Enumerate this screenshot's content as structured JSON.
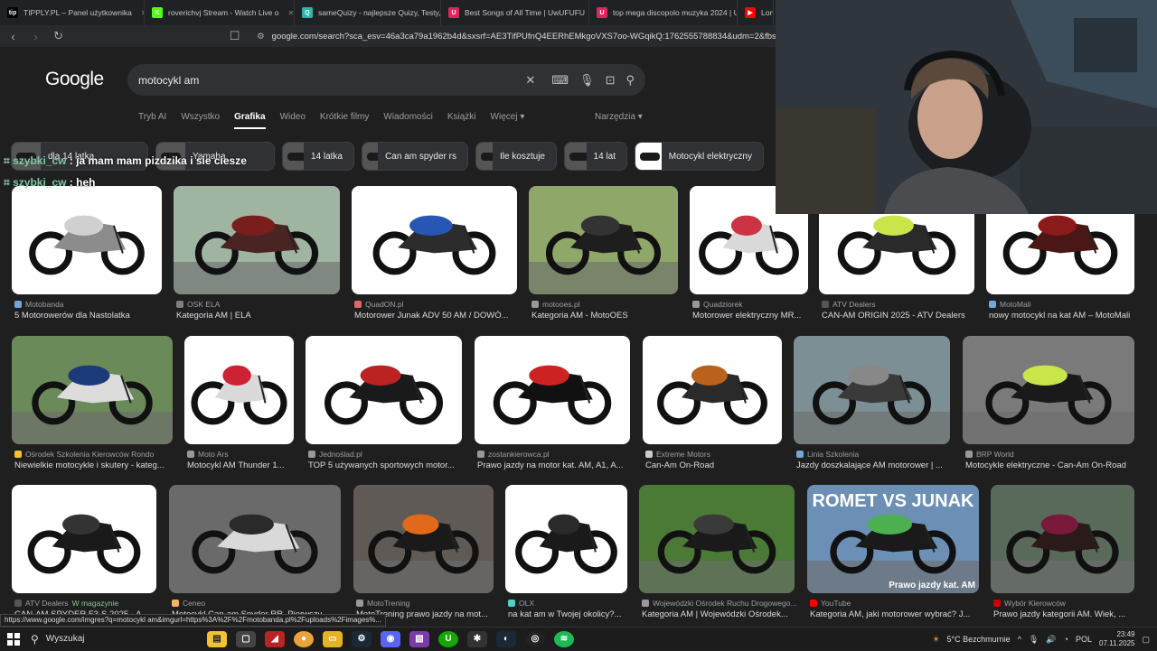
{
  "browser": {
    "tabs": [
      {
        "label": "TIPPLY.PL – Panel użytkownika",
        "fav": "tip",
        "color": "#000000"
      },
      {
        "label": "roverichvj Stream - Watch Live o",
        "fav": "K",
        "color": "#53fc18"
      },
      {
        "label": "sameQuizy - najlepsze Quizy, Testy, C",
        "fav": "Q",
        "color": "#2ab7a9"
      },
      {
        "label": "Best Songs of All Time | UwUFUFU",
        "fav": "U",
        "color": "#e0245e"
      },
      {
        "label": "top mega discopolo muzyka 2024 | U",
        "fav": "U",
        "color": "#e0245e"
      },
      {
        "label": "Long",
        "fav": "▶",
        "color": "#ff0000"
      }
    ],
    "url": "google.com/search?sca_esv=46a3ca79a1962b4d&sxsrf=AE3TifPUfnQ4EERhEMkgoVXS7oo-WGqikQ:1762555788834&udm=2&fbs=AIljpHwV"
  },
  "google": {
    "logo": "Google",
    "query": "motocykl am",
    "tabs": [
      "Tryb AI",
      "Wszystko",
      "Grafika",
      "Wideo",
      "Krótkie filmy",
      "Wiadomości",
      "Książki",
      "Więcej ▾"
    ],
    "active_tab": "Grafika",
    "tools": "Narzędzia ▾",
    "chips": [
      "dla 14 latka",
      "Yamaha",
      "14 latka",
      "Can am spyder rs",
      "Ile kosztuje",
      "14 lat",
      "Motocykl elektryczny"
    ]
  },
  "chat": [
    {
      "user": "szybki_cw",
      "message": "ja mam mam pizdzika i sie ciesze"
    },
    {
      "user": "szybki_cw",
      "message": "heh"
    }
  ],
  "results_rows": [
    [
      {
        "source": "Motobanda",
        "title": "5 Motorowerów dla Nastolatka",
        "icon": "#6fa8dc",
        "bg": "#ffffff",
        "bike": "#8c8c8c",
        "tank": "#d0d0d0"
      },
      {
        "source": "OSK ELA",
        "title": "Kategoria AM | ELA",
        "icon": "#7f7f7f",
        "bg": "#9fb5a1",
        "bike": "#4a2323",
        "tank": "#7a1d1d"
      },
      {
        "source": "QuadON.pl",
        "title": "Motorower Junak ADV 50 AM / DOWÓ...",
        "icon": "#e06666",
        "bg": "#ffffff",
        "bike": "#2c2c2c",
        "tank": "#2856b5"
      },
      {
        "source": "motooes.pl",
        "title": "Kategoria AM - MotoOES",
        "icon": "#999999",
        "bg": "#8fa86a",
        "bike": "#1e1e1e",
        "tank": "#333333"
      },
      {
        "source": "Quadziorek",
        "title": "Motorower elektryczny MR...",
        "icon": "#999999",
        "bg": "#ffffff",
        "bike": "#d9d9d9",
        "tank": "#cc3344"
      },
      {
        "source": "ATV Dealers",
        "title": "CAN-AM ORIGIN 2025 - ATV Dealers",
        "icon": "#555555",
        "bg": "#ffffff",
        "bike": "#2a2a2a",
        "tank": "#c8e64a"
      },
      {
        "source": "MotoMali",
        "title": "nowy motocykl na kat AM – MotoMali",
        "icon": "#6fa8dc",
        "bg": "#ffffff",
        "bike": "#4a1616",
        "tank": "#8b1a1a"
      }
    ],
    [
      {
        "source": "Ośrodek Szkolenia Kierowców Rondo",
        "title": "Niewielkie motocykle i skutery - kateg...",
        "icon": "#f1c232",
        "bg": "#6b8a5a",
        "bike": "#dcdcdc",
        "tank": "#1c3a7a"
      },
      {
        "source": "Moto Ars",
        "title": "Motocykl AM Thunder 1...",
        "icon": "#999999",
        "bg": "#ffffff",
        "bike": "#d9d9d9",
        "tank": "#cc2233"
      },
      {
        "source": "Jednoślad.pl",
        "title": "TOP 5 używanych sportowych motor...",
        "icon": "#999999",
        "bg": "#ffffff",
        "bike": "#1a1a1a",
        "tank": "#bb2222"
      },
      {
        "source": "zostankierowca.pl",
        "title": "Prawo jazdy na motor kat. AM, A1, A...",
        "icon": "#999999",
        "bg": "#ffffff",
        "bike": "#111111",
        "tank": "#cc2222"
      },
      {
        "source": "Extreme Motors",
        "title": "Can-Am On-Road",
        "icon": "#cccccc",
        "bg": "#ffffff",
        "bike": "#2a2a2a",
        "tank": "#b8621e"
      },
      {
        "source": "Linia Szkolenia",
        "title": "Jazdy doszkalające AM motorower | ...",
        "icon": "#6fa8dc",
        "bg": "#7b8f95",
        "bike": "#3a3a3a",
        "tank": "#888888"
      },
      {
        "source": "BRP World",
        "title": "Motocykle elektryczne - Can-Am On-Road",
        "icon": "#999999",
        "bg": "#7a7a7a",
        "bike": "#1a1a1a",
        "tank": "#c8e64a"
      }
    ],
    [
      {
        "source": "ATV Dealers",
        "title": "CAN-AM SPYDER F3-S 2025 - A...",
        "shop": "W magazynie",
        "icon": "#555555",
        "bg": "#ffffff",
        "bike": "#1a1a1a",
        "tank": "#333333"
      },
      {
        "source": "Ceneo",
        "title": "Motocykl Can-am Spyder RR, Pierwszy...",
        "icon": "#f6b26b",
        "bg": "#6a6a6a",
        "bike": "#d9d9d9",
        "tank": "#2a2a2a"
      },
      {
        "source": "MotoTrening",
        "title": "MotoTrening prawo jazdy na mot...",
        "icon": "#999999",
        "bg": "#5f5a55",
        "bike": "#1a1a1a",
        "tank": "#e06a1a"
      },
      {
        "source": "OLX",
        "title": "na kat am w Twojej okolicy?...",
        "icon": "#4fd1c5",
        "bg": "#ffffff",
        "bike": "#1a1a1a",
        "tank": "#2a2a2a"
      },
      {
        "source": "Wojewódzki Ośrodek Ruchu Drogowego...",
        "title": "Kategoria AM | Wojewódzki Ośrodek...",
        "icon": "#999999",
        "bg": "#4a7a35",
        "bike": "#1a1a1a",
        "tank": "#3a3a3a"
      },
      {
        "source": "YouTube",
        "title": "Kategoria AM, jaki motorower wybrać? J...",
        "icon": "#ff0000",
        "bg": "#6b8fb5",
        "bike": "#1a1a1a",
        "tank": "#4caf50",
        "overlay": "ROMET VS JUNAK",
        "overlay2": "Prawo jazdy kat. AM"
      },
      {
        "source": "Wybór Kierowców",
        "title": "Prawo jazdy kategorii AM. Wiek, ...",
        "icon": "#cc0000",
        "bg": "#5a6a5a",
        "bike": "#2a1a1a",
        "tank": "#7a1a3a"
      }
    ]
  ],
  "status_url": "https://www.google.com/imgres?q=motocykl am&imgurl=https%3A%2F%2Fmotobanda.pl%2Fuploads%2Fimages%...",
  "taskbar": {
    "search": "Wyszukaj",
    "weather": "5°C  Bezchmurnie",
    "lang": "POL",
    "time": "23:49",
    "date": "07.11.2025"
  }
}
